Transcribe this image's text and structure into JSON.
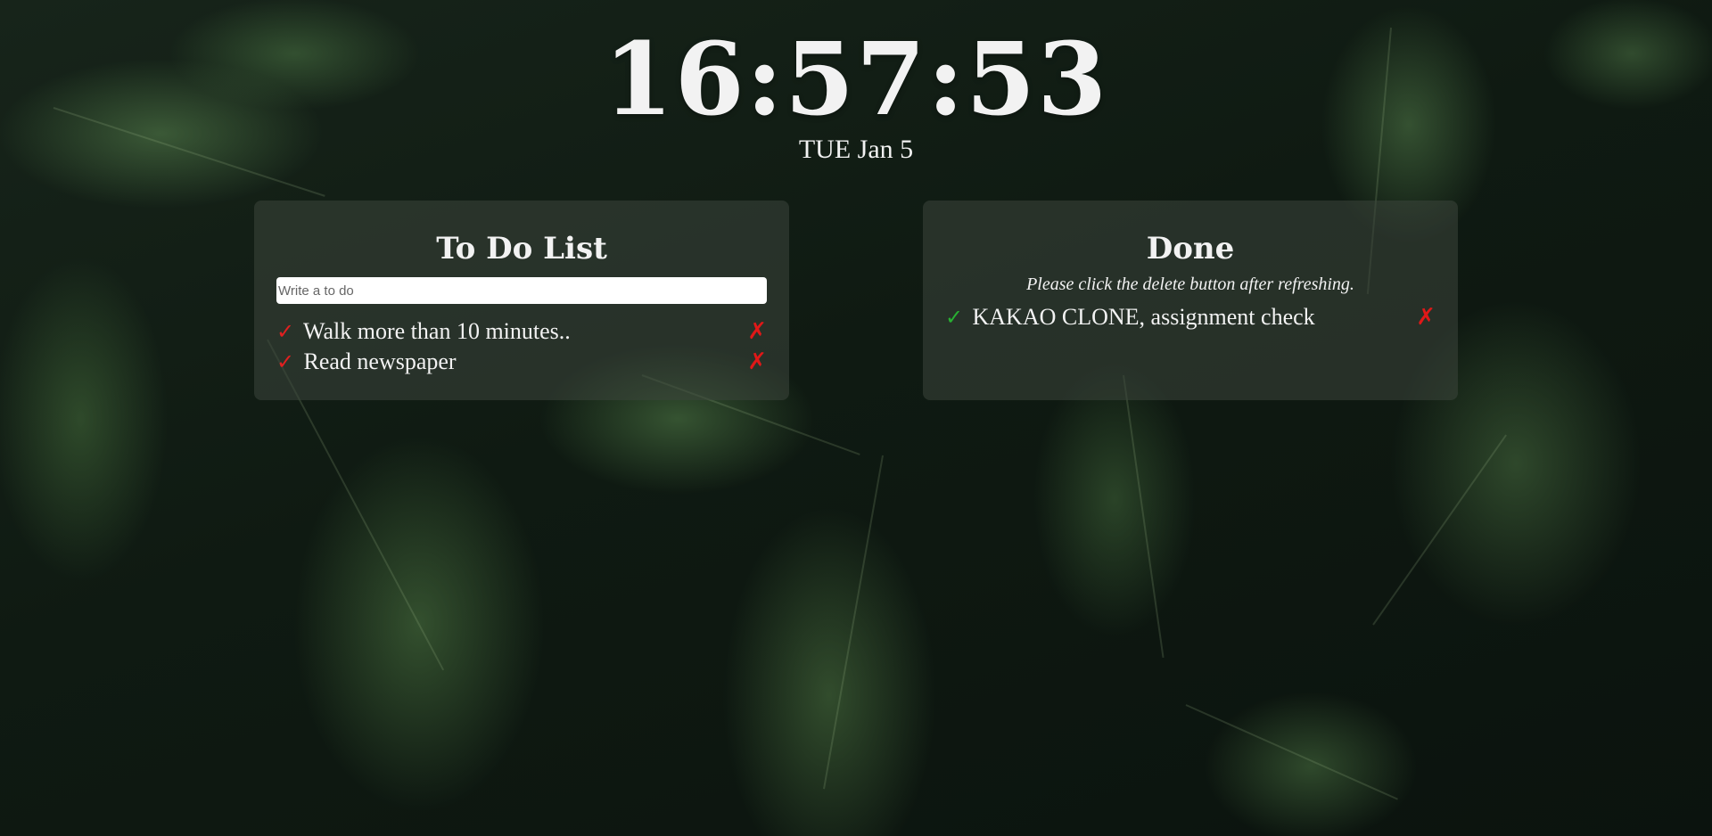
{
  "clock": {
    "time": "16:57:53",
    "date": "TUE Jan 5"
  },
  "todo": {
    "title": "To Do List",
    "input_placeholder": "Write a to do",
    "items": [
      {
        "text": "Walk more than 10 minutes..",
        "check_icon": "✓",
        "delete_icon": "✗"
      },
      {
        "text": "Read newspaper",
        "check_icon": "✓",
        "delete_icon": "✗"
      }
    ]
  },
  "done": {
    "title": "Done",
    "note": "Please click the delete button after refreshing.",
    "items": [
      {
        "text": "KAKAO CLONE, assignment check",
        "check_icon": "✓",
        "delete_icon": "✗"
      }
    ]
  },
  "colors": {
    "todo_check": "#e02020",
    "done_check": "#28b032",
    "delete": "#e01818",
    "panel_bg": "rgba(60,70,60,0.55)"
  }
}
